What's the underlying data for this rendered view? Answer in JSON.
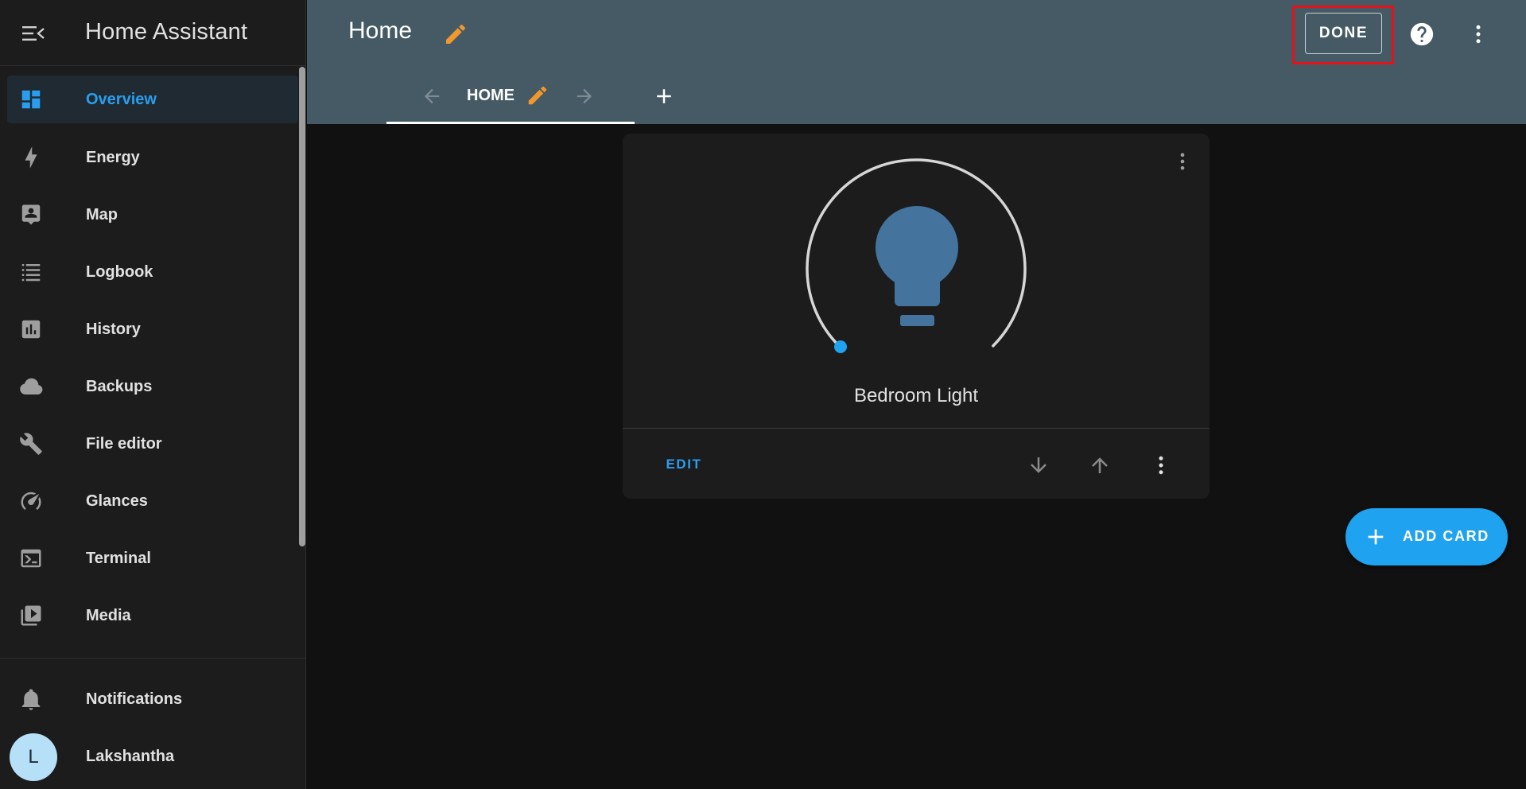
{
  "app": {
    "title": "Home Assistant"
  },
  "sidebar": {
    "items": [
      {
        "label": "Overview",
        "icon": "view-dashboard-icon",
        "active": true
      },
      {
        "label": "Energy",
        "icon": "lightning-bolt-icon"
      },
      {
        "label": "Map",
        "icon": "account-box-icon"
      },
      {
        "label": "Logbook",
        "icon": "format-list-bulleted-icon"
      },
      {
        "label": "History",
        "icon": "chart-box-icon"
      },
      {
        "label": "Backups",
        "icon": "cloud-icon"
      },
      {
        "label": "File editor",
        "icon": "wrench-icon"
      },
      {
        "label": "Glances",
        "icon": "speedometer-icon"
      },
      {
        "label": "Terminal",
        "icon": "console-icon"
      },
      {
        "label": "Media",
        "icon": "play-box-multiple-icon"
      }
    ],
    "notifications_label": "Notifications",
    "user": {
      "initial": "L",
      "name": "Lakshantha"
    }
  },
  "header": {
    "title": "Home",
    "done_label": "DONE",
    "tabs": [
      {
        "label": "HOME"
      }
    ]
  },
  "card": {
    "entity_name": "Bedroom Light",
    "edit_label": "EDIT",
    "brightness": 0,
    "state_color": "#44739e"
  },
  "fab": {
    "label": "ADD CARD"
  },
  "colors": {
    "accent": "#2a9eee",
    "header_bg": "#455a64",
    "edit_pencil": "#f0972e",
    "highlight_box": "#e0141a",
    "fab": "#1fa2f0"
  }
}
